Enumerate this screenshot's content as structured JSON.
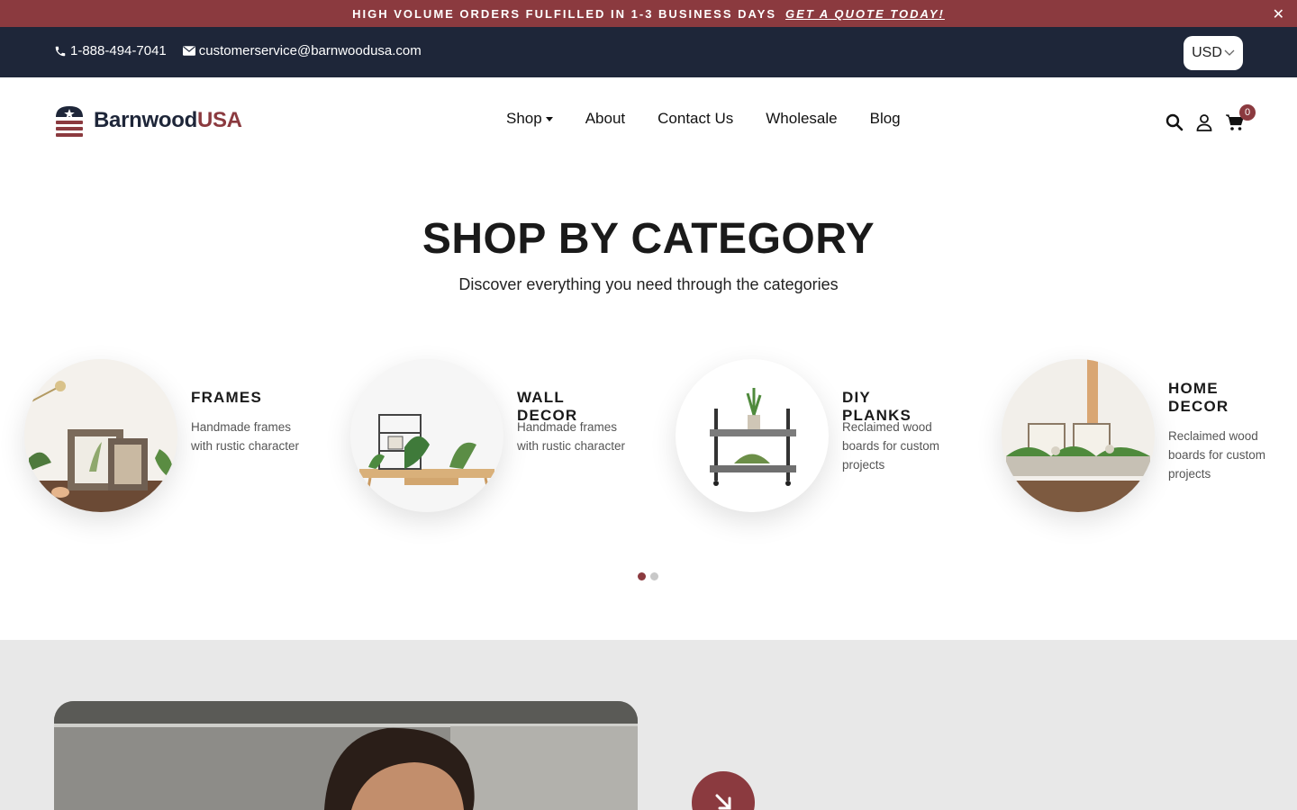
{
  "announcement": {
    "text": "HIGH VOLUME ORDERS FULFILLED IN 1-3 BUSINESS DAYS",
    "cta": "GET A QUOTE TODAY!",
    "close_icon": "close-icon"
  },
  "topbar": {
    "phone": "1-888-494-7041",
    "email": "customerservice@barnwoodusa.com",
    "currency": "USD"
  },
  "header": {
    "logo_part1": "Barnwood",
    "logo_part2": "USA",
    "nav": [
      "Shop",
      "About",
      "Contact Us",
      "Wholesale",
      "Blog"
    ],
    "cart_count": "0"
  },
  "section": {
    "title": "SHOP BY CATEGORY",
    "subtitle": "Discover everything you need through the categories"
  },
  "categories": [
    {
      "title": "FRAMES",
      "desc": "Handmade frames with rustic character"
    },
    {
      "title": "WALL DECOR",
      "desc": "Handmade frames with rustic character"
    },
    {
      "title": "DIY PLANKS",
      "desc": "Reclaimed wood boards for custom projects"
    },
    {
      "title_line1": "HOME",
      "title_line2": "DECOR",
      "desc": "Reclaimed wood boards for custom projects"
    }
  ],
  "carousel": {
    "pages": 2,
    "active": 1
  },
  "colors": {
    "accent": "#8b3a3f",
    "navy": "#1e2639",
    "dot_inactive": "#c8c8c8",
    "lower_bg": "#e8e8e8"
  }
}
